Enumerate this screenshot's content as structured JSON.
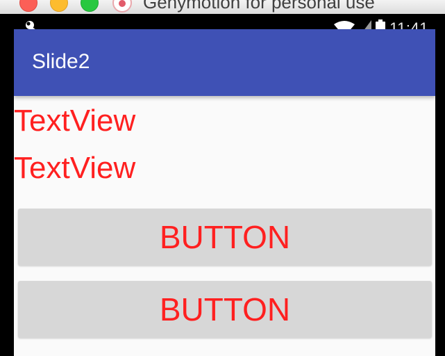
{
  "window": {
    "title": "Genymotion for personal use"
  },
  "status_bar": {
    "time": "11:41",
    "icons": [
      "wrench-icon",
      "wifi-icon",
      "signal-icon",
      "battery-icon"
    ]
  },
  "app_bar": {
    "title": "Slide2",
    "color": "#3f51b5"
  },
  "content": {
    "text_views": [
      "TextView",
      "TextView"
    ],
    "buttons": [
      "BUTTON",
      "BUTTON"
    ],
    "text_color": "#ff2020"
  }
}
